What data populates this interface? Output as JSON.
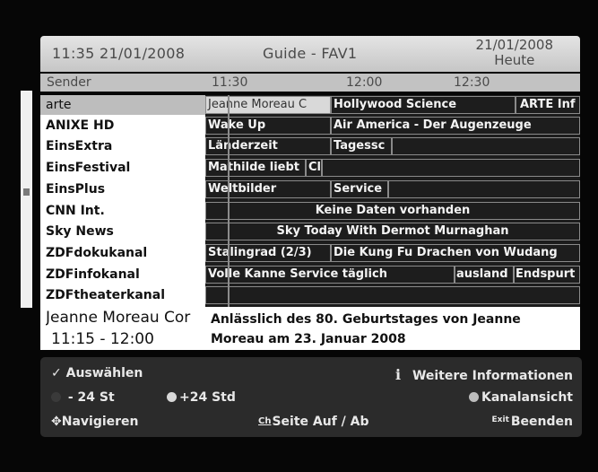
{
  "header": {
    "datetime": "11:35 21/01/2008",
    "title": "Guide - FAV1",
    "date": "21/01/2008",
    "day": "Heute"
  },
  "columns": {
    "sender": "Sender",
    "t1": "11:30",
    "t2": "12:00",
    "t3": "12:30"
  },
  "channels": [
    "arte",
    "ANIXE HD",
    "EinsExtra",
    "EinsFestival",
    "EinsPlus",
    "CNN Int.",
    "Sky News",
    "ZDFdokukanal",
    "ZDFinfokanal",
    "ZDFtheaterkanal"
  ],
  "programs": {
    "arte": [
      "Jeanne Moreau C",
      "Hollywood Science",
      "ARTE Inf"
    ],
    "anixe": [
      "Wake Up",
      "Air America - Der Augenzeuge"
    ],
    "einsextra": [
      "Länderzeit",
      "Tagessc"
    ],
    "einsfestival": [
      "Mathilde liebt",
      "Cl"
    ],
    "einsplus": [
      "Weltbilder",
      "Service"
    ],
    "cnn": [
      "Keine Daten vorhanden"
    ],
    "skynews": [
      "Sky Today With Dermot Murnaghan"
    ],
    "zdfdoku": [
      "Stalingrad (2/3)",
      "Die Kung Fu Drachen von Wudang"
    ],
    "zdfinfo": [
      "Volle Kanne Service täglich",
      "ausland",
      "Endspurt"
    ]
  },
  "info": {
    "title": "Jeanne Moreau Cor",
    "time": "11:15 - 12:00",
    "desc1": "Anlässlich des 80. Geburtstages von Jeanne",
    "desc2": "Moreau am 23. Januar 2008"
  },
  "footer": {
    "select": "Auswählen",
    "more_info": "Weitere Informationen",
    "minus24": "- 24 St",
    "plus24": "+24 Std",
    "channel_view": "Kanalansicht",
    "navigate": "Navigieren",
    "page": "Seite Auf / Ab",
    "exit": "Beenden",
    "exit_key": "Exit",
    "ch_key": "Ch"
  },
  "colors": {
    "red_button": "#3a3a3a",
    "green_button": "#d8d8d8",
    "yellow_button": "#bdbdbd"
  }
}
